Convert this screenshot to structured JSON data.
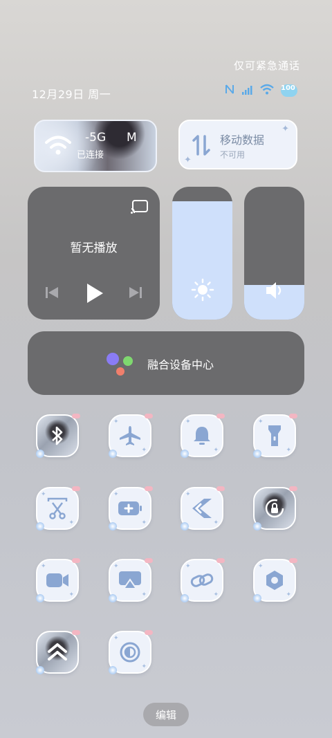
{
  "status": {
    "emergency_only": "仅可紧急通话",
    "date": "12月29日 周一",
    "battery": "100",
    "icons": [
      "nfc-icon",
      "signal-icon",
      "wifi-icon",
      "battery-icon"
    ]
  },
  "wifi_tile": {
    "name": "-5G",
    "name_suffix": "M",
    "status": "已连接"
  },
  "mobile_tile": {
    "label": "移动数据",
    "status": "不可用"
  },
  "media": {
    "title": "暂无播放"
  },
  "sliders": {
    "brightness_level": 0.89,
    "volume_level": 0.26
  },
  "fusion": {
    "label": "融合设备中心"
  },
  "tiles": [
    {
      "icon": "bluetooth-icon",
      "style": "photo"
    },
    {
      "icon": "airplane-icon",
      "style": "plain"
    },
    {
      "icon": "bell-icon",
      "style": "plain"
    },
    {
      "icon": "flashlight-icon",
      "style": "plain"
    },
    {
      "icon": "screenshot-scissors-icon",
      "style": "plain"
    },
    {
      "icon": "battery-saver-icon",
      "style": "plain"
    },
    {
      "icon": "share-chevron-icon",
      "style": "plain"
    },
    {
      "icon": "rotation-lock-icon",
      "style": "photo"
    },
    {
      "icon": "screen-record-icon",
      "style": "plain"
    },
    {
      "icon": "screen-cast-icon",
      "style": "plain"
    },
    {
      "icon": "link-icon",
      "style": "plain"
    },
    {
      "icon": "settings-hex-icon",
      "style": "plain"
    },
    {
      "icon": "double-chevron-up-icon",
      "style": "photo"
    },
    {
      "icon": "dark-mode-icon",
      "style": "plain"
    }
  ],
  "edit_label": "编辑",
  "colors": {
    "accent_blue": "#5aa9e8",
    "tile_bg": "#eef2fa",
    "panel_gray": "#6b6b6d",
    "slider_fill": "#cfe0fb",
    "icon_blue": "#8aa6d2"
  }
}
